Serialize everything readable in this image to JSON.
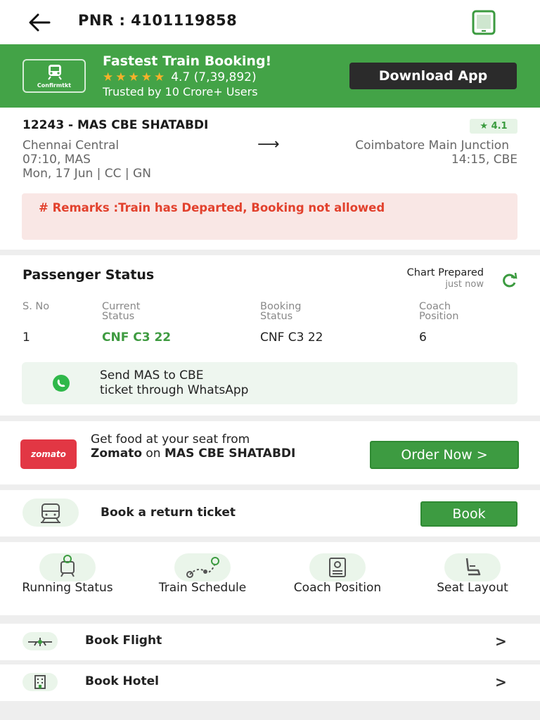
{
  "header": {
    "pnr_label": "PNR : 4101119858"
  },
  "banner": {
    "logo_text": "Confirmtkt",
    "title": "Fastest Train Booking!",
    "stars": "★★★★★",
    "rating": "4.7 (7,39,892)",
    "subtitle": "Trusted by 10 Crore+ Users",
    "download_label": "Download App"
  },
  "train": {
    "name": "12243 - MAS CBE SHATABDI",
    "rating": "★ 4.1",
    "from_station": "Chennai Central",
    "to_station": "Coimbatore Main Junction",
    "departure": "07:10, MAS",
    "arrival": "14:15, CBE",
    "journey_info": "Mon, 17 Jun  |  CC  |  GN",
    "remarks": "# Remarks :Train has Departed, Booking not allowed"
  },
  "passenger_status": {
    "title": "Passenger Status",
    "chart_status": "Chart Prepared",
    "chart_time": "just now",
    "headers": {
      "sno": "S. No",
      "current": "Current Status",
      "booking": "Booking Status",
      "coach": "Coach Position"
    },
    "rows": [
      {
        "sno": "1",
        "current": "CNF C3 22",
        "booking": "CNF C3 22",
        "coach": "6"
      }
    ],
    "whatsapp_line1": "Send MAS to CBE",
    "whatsapp_line2": "ticket through WhatsApp"
  },
  "food": {
    "logo": "zomato",
    "line1": "Get food at your seat from",
    "brand": "Zomato",
    "on": "on",
    "train": "MAS CBE SHATABDI",
    "order_label": "Order Now >"
  },
  "return_ticket": {
    "label": "Book a return ticket",
    "button": "Book"
  },
  "quick_actions": [
    {
      "label": "Running Status",
      "icon": "running-status-icon"
    },
    {
      "label": "Train Schedule",
      "icon": "train-schedule-icon"
    },
    {
      "label": "Coach Position",
      "icon": "coach-position-icon"
    },
    {
      "label": "Seat Layout",
      "icon": "seat-layout-icon"
    }
  ],
  "list": [
    {
      "label": "Book Flight",
      "icon": "flight-icon"
    },
    {
      "label": "Book Hotel",
      "icon": "hotel-icon"
    }
  ],
  "colors": {
    "brand_green": "#43a347",
    "button_green": "#3d9b41",
    "remarks_red": "#e2412d",
    "zomato_red": "#e23744"
  }
}
